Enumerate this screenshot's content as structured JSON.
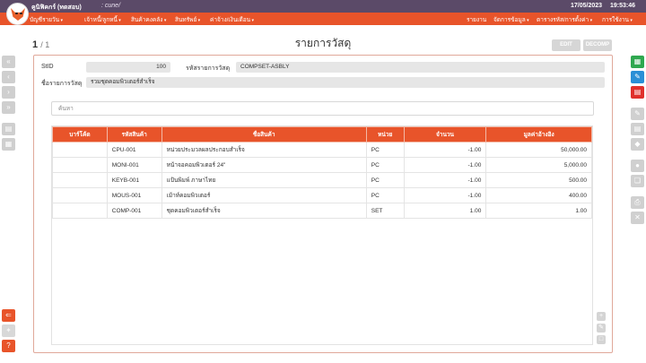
{
  "topbar": {
    "company": "คูนิฟิคกร์ (ทดสอบ)",
    "user": ": cune/",
    "date": "17/05/2023",
    "time": "19:53:46"
  },
  "menu": {
    "left": [
      "บัญชีรายวัน",
      "เจ้าหนี้/ลูกหนี้",
      "สินค้าคงคลัง",
      "สินทรัพย์",
      "ค่าจ้าง/เงินเดือน"
    ],
    "right": [
      "รายงาน",
      "จัดการข้อมูล",
      "ตารางรหัส/การตั้งค่า",
      "การใช้งาน"
    ]
  },
  "header": {
    "page_current": "1",
    "page_total": "/ 1",
    "title": "รายการวัสดุ",
    "edit_label": "EDIT",
    "decomp_label": "DECOMP"
  },
  "form": {
    "stid_label": "StID",
    "stid_value": "100",
    "code_label": "รหัสรายการวัสดุ",
    "code_value": "COMPSET-ASBLY",
    "name_label": "ชื่อรายการวัสดุ",
    "name_value": "รวมชุดคอมพิวเตอร์สำเร็จ"
  },
  "search": {
    "placeholder": "ค้นหา"
  },
  "table": {
    "columns": [
      "บาร์โค้ด",
      "รหัสสินค้า",
      "ชื่อสินค้า",
      "หน่วย",
      "จำนวน",
      "มูลค่าอ้างอิง"
    ],
    "rows": [
      {
        "barcode": "",
        "code": "CPU-001",
        "name": "หน่วยประมวลผลประกอบสำเร็จ",
        "unit": "PC",
        "qty": "-1.00",
        "value": "50,000.00"
      },
      {
        "barcode": "",
        "code": "MONI-001",
        "name": "หน้าจอคอมพิวเตอร์ 24\"",
        "unit": "PC",
        "qty": "-1.00",
        "value": "5,000.00"
      },
      {
        "barcode": "",
        "code": "KEYB-001",
        "name": "แป้นพิมพ์ ภาษาไทย",
        "unit": "PC",
        "qty": "-1.00",
        "value": "500.00"
      },
      {
        "barcode": "",
        "code": "MOUS-001",
        "name": "เม้าท์คอมพิวเตอร์",
        "unit": "PC",
        "qty": "-1.00",
        "value": "400.00"
      },
      {
        "barcode": "",
        "code": "COMP-001",
        "name": "ชุดคอมพิวเตอร์สำเร็จ",
        "unit": "SET",
        "qty": "1.00",
        "value": "1.00"
      }
    ]
  },
  "colors": {
    "accent": "#e8542a",
    "topbar": "#5b4a68"
  },
  "icons": {
    "left": [
      "double-chevron-up-icon",
      "chevron-left-icon",
      "chevron-right-icon",
      "double-chevron-down-icon",
      "document-list-icon",
      "table-icon",
      "back-arrow-icon",
      "pin-icon",
      "help-icon"
    ],
    "right": [
      "excel-export-icon",
      "edit-icon",
      "pdf-export-icon",
      "pencil-icon",
      "copy-icon",
      "tag-icon",
      "user-icon",
      "duplicate-icon",
      "print-icon",
      "close-icon"
    ]
  }
}
